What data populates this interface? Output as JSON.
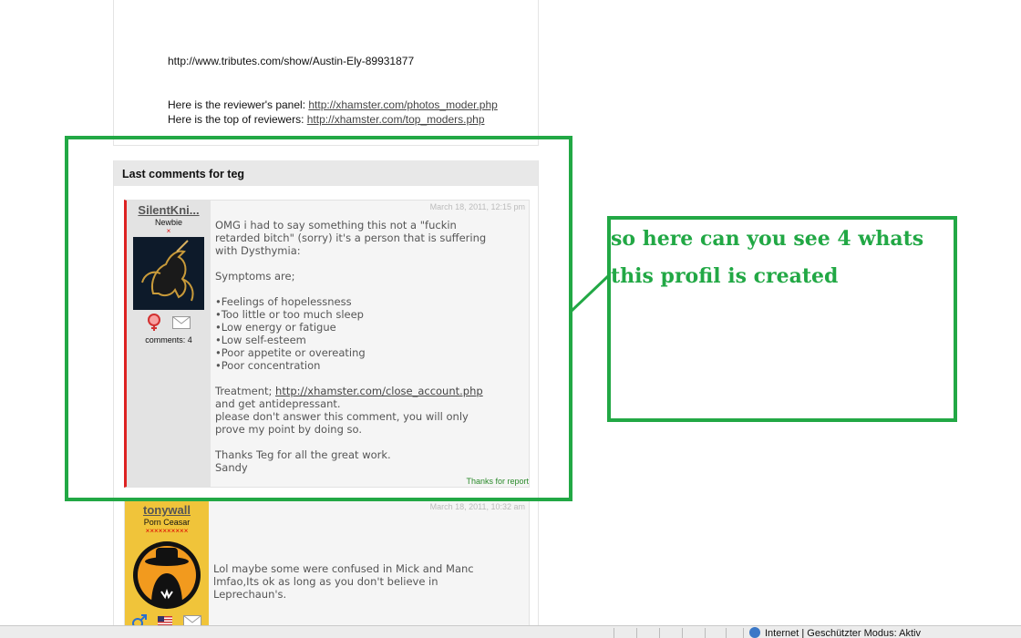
{
  "top_panel": {
    "tribute_url": "http://www.tributes.com/show/Austin-Ely-89931877",
    "reviewer_panel_prefix": "Here is the reviewer's panel: ",
    "reviewer_panel_link": "http://xhamster.com/photos_moder.php",
    "top_reviewers_prefix": "Here is the top of reviewers: ",
    "top_reviewers_link": "http://xhamster.com/top_moders.php"
  },
  "comments_section": {
    "header": "Last comments for teg",
    "comments": [
      {
        "username": "SilentKni...",
        "rank": "Newbie",
        "rank_stars": "×",
        "count": "comments: 4",
        "date": "March 18, 2011, 12:15 pm",
        "lines": [
          "OMG i had to say something this not a \"fuckin",
          "retarded bitch\" (sorry) it's a person that is suffering",
          "with Dysthymia:",
          "",
          "Symptoms are;",
          "",
          "•Feelings of hopelessness",
          "•Too little or too much sleep",
          "•Low energy or fatigue",
          "•Low self-esteem",
          "•Poor appetite or overeating",
          "•Poor concentration",
          ""
        ],
        "treatment_prefix": "Treatment; ",
        "treatment_link": "http://xhamster.com/close_account.php",
        "lines_after": [
          "and get antidepressant.",
          "please don't answer this comment, you will only",
          "prove my point by doing so.",
          "",
          "Thanks Teg for all the great work.",
          "Sandy"
        ],
        "report_label": "Thanks for report"
      },
      {
        "username": "tonywall",
        "rank": "Porn Ceasar",
        "rank_stars": "××××××××××",
        "date": "March 18, 2011, 10:32 am",
        "lines": [
          "Lol maybe some were confused in Mick and Manc",
          "lmfao,Its ok as long as you don't believe in",
          "Leprechaun's."
        ]
      }
    ]
  },
  "annotation": {
    "line1": "so here can you see 4 whats",
    "line2": "this profil is created",
    "color": "#22a845"
  },
  "status_bar": {
    "zone_text": "Internet | Geschützter Modus: Aktiv"
  }
}
